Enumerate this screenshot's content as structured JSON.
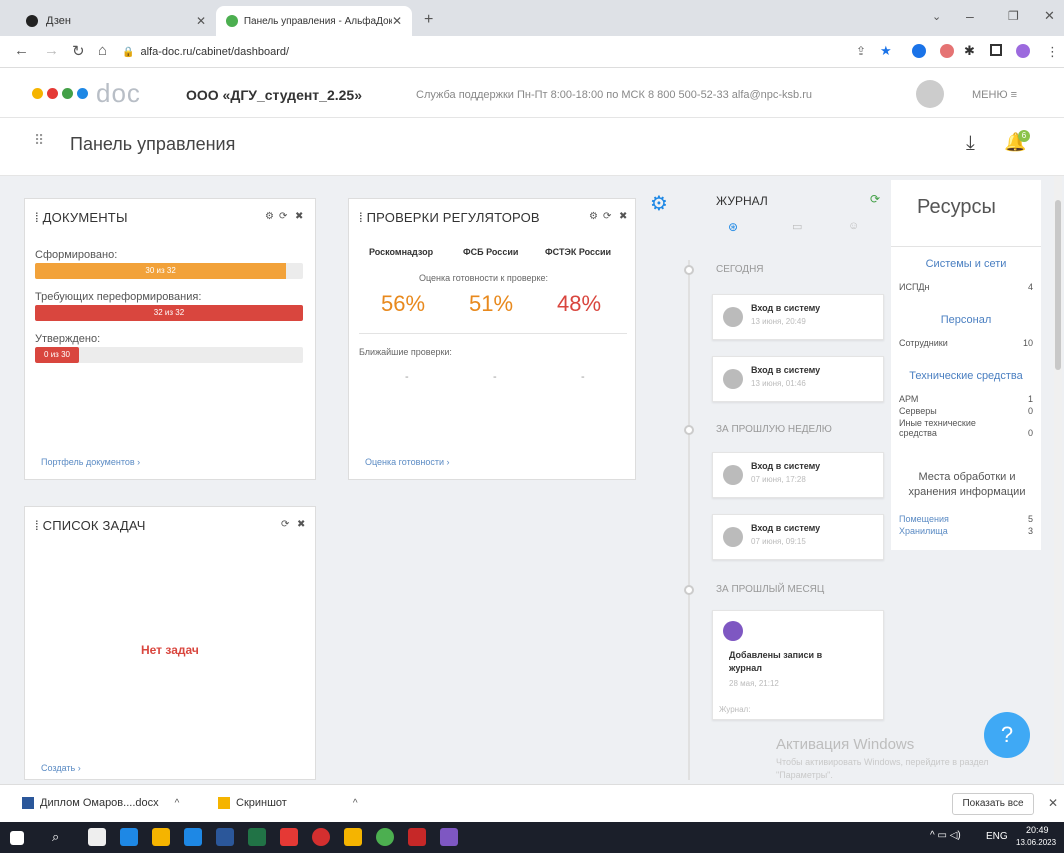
{
  "browser": {
    "tabs": [
      {
        "label": "Дзен"
      },
      {
        "label": "Панель управления - АльфаДок"
      }
    ],
    "url": "alfa-doc.ru/cabinet/dashboard/"
  },
  "header": {
    "logo_text": "doc",
    "company": "ООО «ДГУ_студент_2.25»",
    "support": "Служба поддержки   Пн-Пт 8:00-18:00 по МСК   8 800 500-52-33   alfa@npc-ksb.ru",
    "menu_label": "МЕНЮ ≡"
  },
  "page": {
    "title": "Панель управления",
    "notif_count": "6"
  },
  "documents": {
    "title": "ДОКУМЕНТЫ",
    "formed_label": "Сформировано:",
    "formed_value": "30 из 32",
    "formed_fraction": 0.9375,
    "reform_label": "Требующих переформирования:",
    "reform_value": "32 из 32",
    "reform_fraction": 1.0,
    "approved_label": "Утверждено:",
    "approved_value": "0 из 30",
    "approved_fraction": 0,
    "link": "Портфель документов ›",
    "colors": {
      "orange": "#f2a23a",
      "red": "#d9463e"
    }
  },
  "regulators": {
    "title": "ПРОВЕРКИ РЕГУЛЯТОРОВ",
    "orgs": [
      "Роскомнадзор",
      "ФСБ России",
      "ФСТЭК России"
    ],
    "readiness_label": "Оценка готовности к проверке:",
    "values": [
      "56%",
      "51%",
      "48%"
    ],
    "colors": [
      "#e8891d",
      "#e8891d",
      "#d9463e"
    ],
    "upcoming_label": "Ближайшие проверки:",
    "dashes": [
      "-",
      "-",
      "-"
    ],
    "link": "Оценка готовности ›"
  },
  "tasks": {
    "title": "СПИСОК ЗАДАЧ",
    "empty": "Нет задач",
    "link": "Создать ›"
  },
  "journal": {
    "title": "ЖУРНАЛ",
    "today": "СЕГОДНЯ",
    "last_week": "ЗА ПРОШЛУЮ НЕДЕЛЮ",
    "last_month": "ЗА ПРОШЛЫЙ МЕСЯЦ",
    "entries": [
      {
        "title": "Вход в систему",
        "date": "13 июня, 20:49"
      },
      {
        "title": "Вход в систему",
        "date": "13 июня, 01:46"
      },
      {
        "title": "Вход в систему",
        "date": "07 июня, 17:28"
      },
      {
        "title": "Вход в систему",
        "date": "07 июня, 09:15"
      }
    ],
    "month_entry": {
      "title": "Добавлены записи в журнал",
      "date": "28 мая, 21:12"
    },
    "footer": "Журнал:"
  },
  "resources": {
    "title": "Ресурсы",
    "systems": "Системы и сети",
    "ispdn": {
      "label": "ИСПДн",
      "value": "4"
    },
    "personnel": "Персонал",
    "employees": {
      "label": "Сотрудники",
      "value": "10"
    },
    "tech": "Технические средства",
    "arm": {
      "label": "АРМ",
      "value": "1"
    },
    "servers": {
      "label": "Серверы",
      "value": "0"
    },
    "other_tech": {
      "label": "Иные технические средства",
      "value": "0"
    },
    "places": "Места обработки и хранения информации",
    "rooms": {
      "label": "Помещения",
      "value": "5"
    },
    "storage": {
      "label": "Хранилища",
      "value": "3"
    }
  },
  "watermark": {
    "line1": "Активация Windows",
    "line2": "Чтобы активировать Windows, перейдите в раздел \"Параметры\"."
  },
  "downloads": {
    "file1": "Диплом Омаров....docx",
    "file2": "Скриншот",
    "show_all": "Показать все"
  },
  "taskbar": {
    "lang": "ENG",
    "time": "20:49",
    "date": "13.06.2023"
  }
}
